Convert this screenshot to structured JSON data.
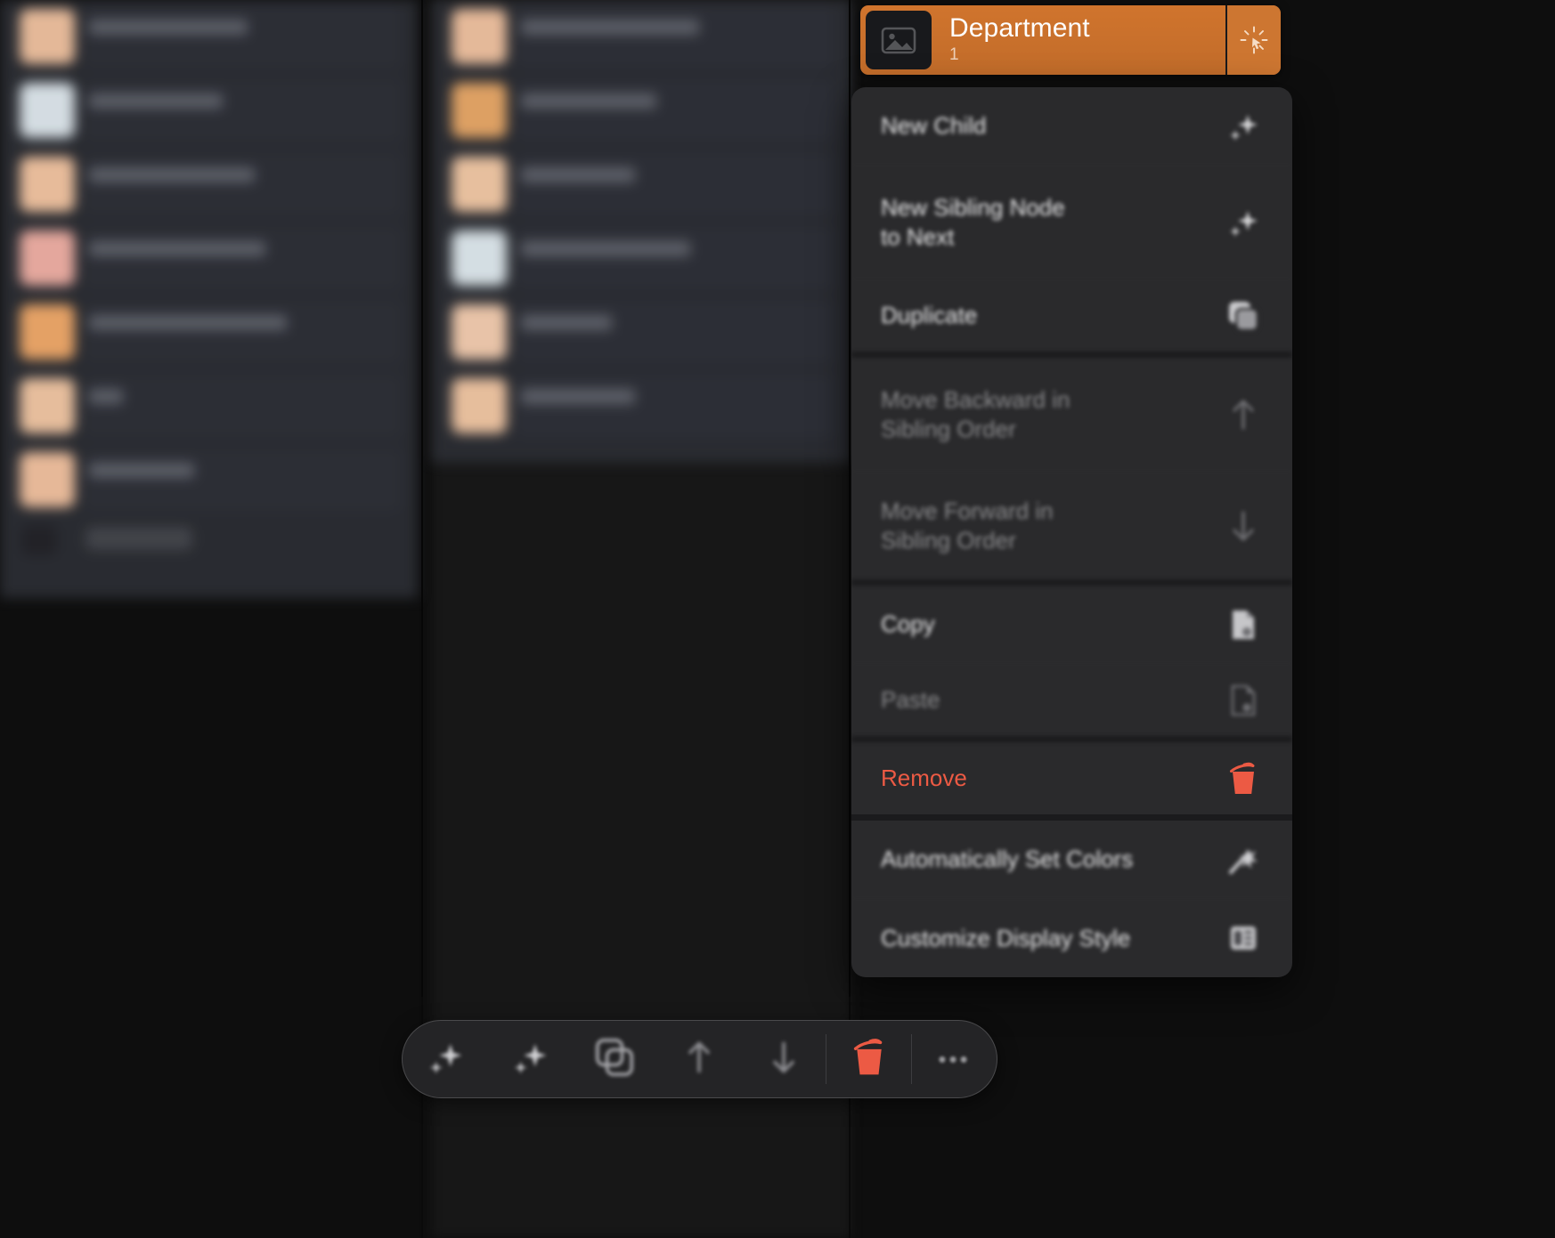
{
  "app": {
    "background_color": "#0e0e0e",
    "accent_orange": "#d0742d",
    "danger_red": "#ec5a44",
    "menu_background": "#2a2a2c"
  },
  "node_header": {
    "title": "Department",
    "subtitle": "1",
    "thumbnail_icon": "image-placeholder-icon",
    "action_icon": "tap-cursor-icon",
    "background_color": "#d0742d"
  },
  "context_menu": {
    "items": [
      {
        "label": "New Child",
        "icon": "sparkle-add-icon",
        "state": "enabled",
        "blurred": true
      },
      {
        "label": "New Sibling Node\nto Next",
        "icon": "sparkle-add-icon",
        "state": "enabled",
        "blurred": true
      },
      {
        "label": "Duplicate",
        "icon": "duplicate-icon",
        "state": "enabled",
        "blurred": true
      },
      {
        "label": "Move Backward in\nSibling Order",
        "icon": "arrow-up-icon",
        "state": "disabled",
        "blurred": true
      },
      {
        "label": "Move Forward in\nSibling Order",
        "icon": "arrow-down-icon",
        "state": "disabled",
        "blurred": true
      },
      {
        "label": "Copy",
        "icon": "copy-icon",
        "state": "enabled",
        "blurred": true
      },
      {
        "label": "Paste",
        "icon": "paste-icon",
        "state": "disabled",
        "blurred": true
      },
      {
        "label": "Remove",
        "icon": "trash-icon",
        "state": "danger",
        "blurred": false
      },
      {
        "label": "Automatically Set Colors",
        "icon": "magic-wand-icon",
        "state": "enabled",
        "blurred": true
      },
      {
        "label": "Customize Display Style",
        "icon": "display-style-icon",
        "state": "enabled",
        "blurred": true
      }
    ],
    "item_labels": {
      "new_child": "New Child",
      "new_sibling_line1": "New Sibling Node",
      "new_sibling_line2": "to Next",
      "duplicate": "Duplicate",
      "move_backward_line1": "Move Backward in",
      "move_backward_line2": "Sibling Order",
      "move_forward_line1": "Move Forward in",
      "move_forward_line2": "Sibling Order",
      "copy": "Copy",
      "paste": "Paste",
      "remove": "Remove",
      "auto_colors": "Automatically Set Colors",
      "customize_style": "Customize Display Style"
    }
  },
  "bottom_toolbar": {
    "buttons": [
      {
        "name": "new-child-button",
        "icon": "sparkle-add-icon"
      },
      {
        "name": "new-sibling-button",
        "icon": "sparkle-add-icon"
      },
      {
        "name": "duplicate-button",
        "icon": "duplicate-icon"
      },
      {
        "name": "move-up-button",
        "icon": "arrow-up-icon"
      },
      {
        "name": "move-down-button",
        "icon": "arrow-down-icon"
      },
      {
        "name": "delete-button",
        "icon": "trash-icon"
      },
      {
        "name": "more-button",
        "icon": "ellipsis-icon",
        "label": "•••"
      }
    ],
    "more_label": "•••"
  },
  "background_lists": {
    "left_column": {
      "rows": [
        {
          "line1_width": 178,
          "line2_width": 0,
          "thumb": "#f0c2a0"
        },
        {
          "line1_width": 150,
          "line2_width": 0,
          "thumb": "#dfe8ee"
        },
        {
          "line1_width": 186,
          "line2_width": 0,
          "thumb": "#f3c5a2"
        },
        {
          "line1_width": 198,
          "line2_width": 0,
          "thumb": "#f0b0a5"
        },
        {
          "line1_width": 222,
          "line2_width": 0,
          "thumb": "#f0a96a"
        },
        {
          "line1_width": 38,
          "line2_width": 0,
          "thumb": "#f2c7a4"
        },
        {
          "line1_width": 118,
          "line2_width": 0,
          "thumb": "#f2c2a0"
        }
      ],
      "footer_pill_width": 120
    },
    "middle_column": {
      "rows": [
        {
          "line1_width": 200,
          "thumb": "#f0c2a0"
        },
        {
          "line1_width": 152,
          "thumb": "#e8a868"
        },
        {
          "line1_width": 128,
          "thumb": "#f3c9a6"
        },
        {
          "line1_width": 190,
          "thumb": "#dfe9ee"
        },
        {
          "line1_width": 102,
          "thumb": "#f4cdb0"
        },
        {
          "line1_width": 128,
          "thumb": "#f2c7a4"
        }
      ]
    }
  }
}
